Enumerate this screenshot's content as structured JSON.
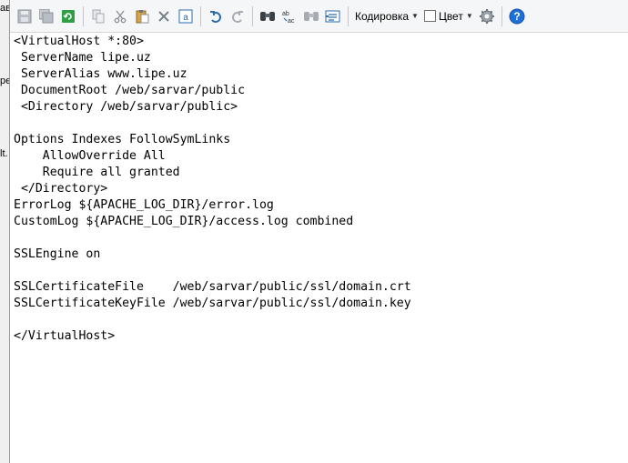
{
  "left_strip": {
    "fragments": [
      "ав",
      "ре,",
      "lt."
    ]
  },
  "toolbar": {
    "encoding_label": "Кодировка",
    "color_label": "Цвет",
    "icons": [
      "save-icon",
      "save-all-icon",
      "reload-icon",
      "copy-icon",
      "cut-icon",
      "paste-icon",
      "delete-icon",
      "select-all-icon",
      "undo-icon",
      "redo-icon",
      "find-icon",
      "replace-icon",
      "find-in-files-icon",
      "goto-icon",
      "settings-icon",
      "help-icon"
    ]
  },
  "editor": {
    "lines": [
      "<VirtualHost *:80>",
      " ServerName lipe.uz",
      " ServerAlias www.lipe.uz",
      " DocumentRoot /web/sarvar/public",
      " <Directory /web/sarvar/public>",
      "",
      "Options Indexes FollowSymLinks",
      "    AllowOverride All",
      "    Require all granted",
      " </Directory>",
      "ErrorLog ${APACHE_LOG_DIR}/error.log",
      "CustomLog ${APACHE_LOG_DIR}/access.log combined",
      "",
      "SSLEngine on",
      "",
      "SSLCertificateFile    /web/sarvar/public/ssl/domain.crt",
      "SSLCertificateKeyFile /web/sarvar/public/ssl/domain.key",
      "",
      "</VirtualHost>"
    ]
  }
}
